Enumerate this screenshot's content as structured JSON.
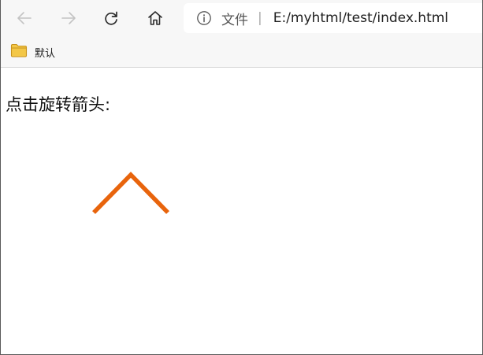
{
  "browser": {
    "site_label": "文件",
    "separator": "|",
    "url": "E:/myhtml/test/index.html"
  },
  "bookmarks": [
    {
      "label": "默认",
      "icon": "folder-icon"
    }
  ],
  "page": {
    "heading": "点击旋转箭头:",
    "arrow": {
      "icon": "chevron-up-icon",
      "color": "#e8640c"
    }
  }
}
